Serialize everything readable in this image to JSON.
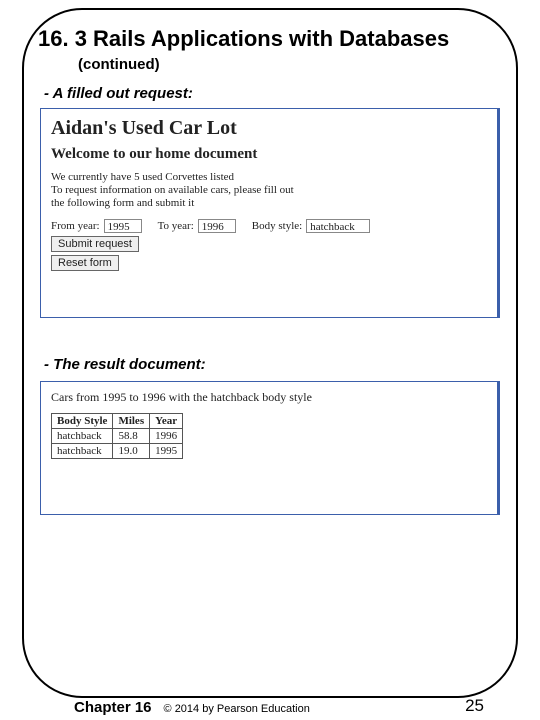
{
  "slide": {
    "title": "16. 3 Rails Applications with Databases",
    "continued": "(continued)",
    "bullet1": "- A filled out request:",
    "bullet2": "- The result document:"
  },
  "shot1": {
    "lot_title": "Aidan's Used Car Lot",
    "welcome": "Welcome to our home document",
    "line1": "We currently have 5 used Corvettes listed",
    "line2": "To request information on available cars, please fill out",
    "line3": "the following form and submit it",
    "from_label": "From year:",
    "from_value": "1995",
    "to_label": "To year:",
    "to_value": "1996",
    "body_label": "Body style:",
    "body_value": "hatchback",
    "submit_label": "Submit request",
    "reset_label": "Reset form"
  },
  "shot2": {
    "result_line": "Cars from 1995 to 1996 with the hatchback body style",
    "headers": {
      "c1": "Body Style",
      "c2": "Miles",
      "c3": "Year"
    },
    "rows": [
      {
        "c1": "hatchback",
        "c2": "58.8",
        "c3": "1996"
      },
      {
        "c1": "hatchback",
        "c2": "19.0",
        "c3": "1995"
      }
    ]
  },
  "footer": {
    "chapter": "Chapter 16",
    "copyright": "© 2014 by Pearson Education",
    "page": "25"
  }
}
